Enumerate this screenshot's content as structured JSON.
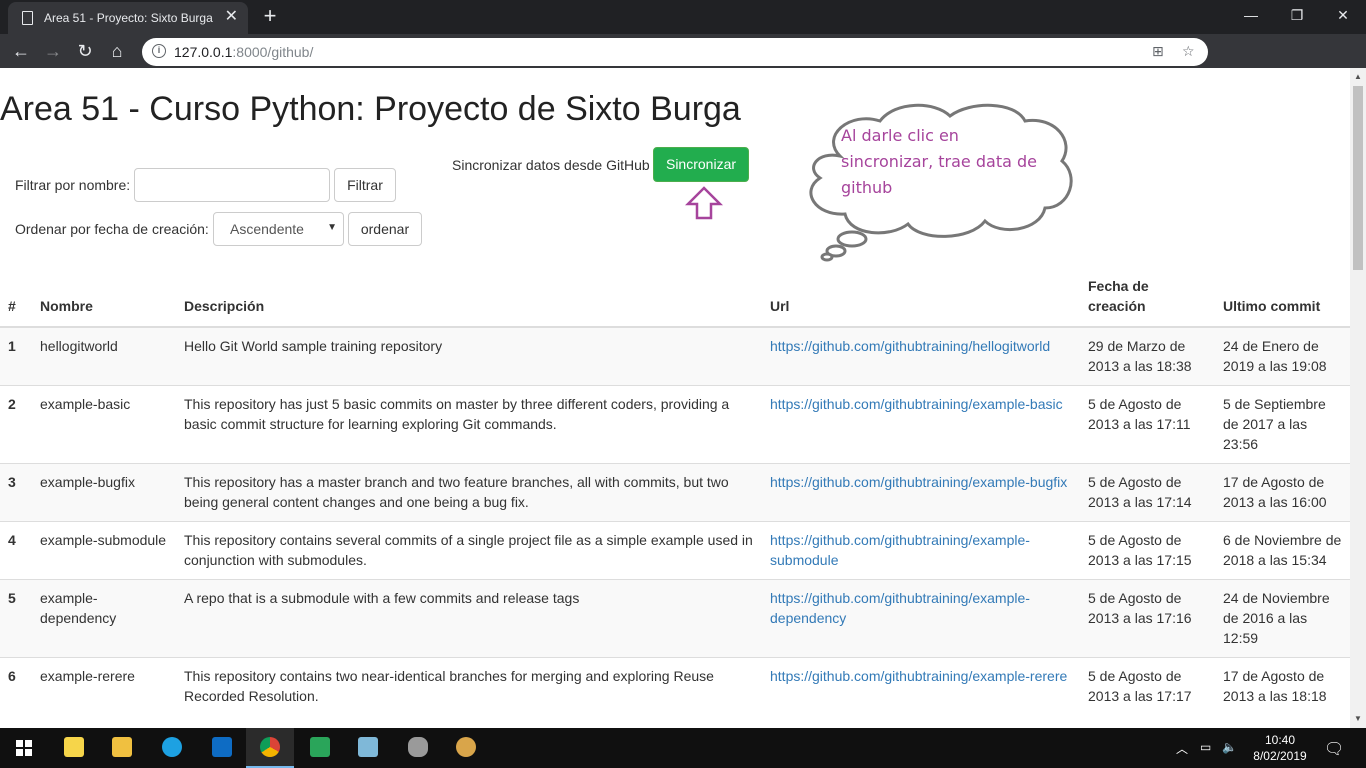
{
  "browser": {
    "tab_title": "Area 51 - Proyecto: Sixto Burga",
    "url_host": "127.0.0.1",
    "url_path": ":8000/github/"
  },
  "page": {
    "heading": "Area 51 - Curso Python: Proyecto de Sixto Burga",
    "filter_label": "Filtrar por nombre:",
    "filter_value": "",
    "filter_button": "Filtrar",
    "sort_label": "Ordenar por fecha de creación:",
    "sort_selected": "Ascendente",
    "sort_button": "ordenar",
    "sync_label": "Sincronizar datos desde GitHub",
    "sync_button": "Sincronizar",
    "callout_line1": "Al darle clic en",
    "callout_line2": "sincronizar, trae data de",
    "callout_line3": "github"
  },
  "table": {
    "headers": {
      "num": "#",
      "name": "Nombre",
      "desc": "Descripción",
      "url": "Url",
      "created_1": "Fecha de",
      "created_2": "creación",
      "commit": "Ultimo commit"
    },
    "rows": [
      {
        "num": "1",
        "name": "hellogitworld",
        "desc": "Hello Git World sample training repository",
        "url": "https://github.com/githubtraining/hellogitworld",
        "created": "29 de Marzo de 2013 a las 18:38",
        "commit": "24 de Enero de 2019 a las 19:08"
      },
      {
        "num": "2",
        "name": "example-basic",
        "desc": "This repository has just 5 basic commits on master by three different coders, providing a basic commit structure for learning exploring Git commands.",
        "url": "https://github.com/githubtraining/example-basic",
        "created": "5 de Agosto de 2013 a las 17:11",
        "commit": "5 de Septiembre de 2017 a las 23:56"
      },
      {
        "num": "3",
        "name": "example-bugfix",
        "desc": "This repository has a master branch and two feature branches, all with commits, but two being general content changes and one being a bug fix.",
        "url": "https://github.com/githubtraining/example-bugfix",
        "created": "5 de Agosto de 2013 a las 17:14",
        "commit": "17 de Agosto de 2013 a las 16:00"
      },
      {
        "num": "4",
        "name": "example-submodule",
        "desc": "This repository contains several commits of a single project file as a simple example used in conjunction with submodules.",
        "url": "https://github.com/githubtraining/example-submodule",
        "created": "5 de Agosto de 2013 a las 17:15",
        "commit": "6 de Noviembre de 2018 a las 15:34"
      },
      {
        "num": "5",
        "name": "example-dependency",
        "desc": "A repo that is a submodule with a few commits and release tags",
        "url": "https://github.com/githubtraining/example-dependency",
        "created": "5 de Agosto de 2013 a las 17:16",
        "commit": "24 de Noviembre de 2016 a las 12:59"
      },
      {
        "num": "6",
        "name": "example-rerere",
        "desc": "This repository contains two near-identical branches for merging and exploring Reuse Recorded Resolution.",
        "url": "https://github.com/githubtraining/example-rerere",
        "created": "5 de Agosto de 2013 a las 17:17",
        "commit": "17 de Agosto de 2013 a las 18:18"
      }
    ]
  },
  "taskbar": {
    "time": "10:40",
    "date": "8/02/2019"
  }
}
